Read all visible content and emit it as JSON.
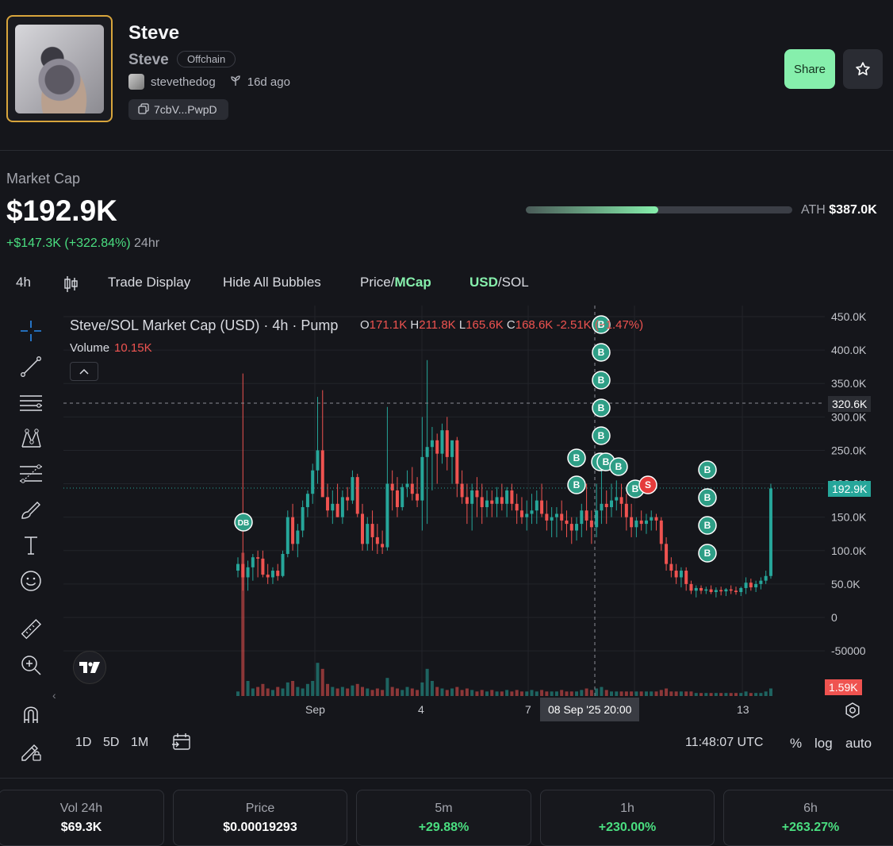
{
  "token": {
    "name": "Steve",
    "symbol": "Steve",
    "status_badge": "Offchain",
    "creator": "stevethedog",
    "age": "16d ago",
    "address": "7cbV...PwpD"
  },
  "actions": {
    "share_label": "Share",
    "favorite_icon": "star-icon"
  },
  "market_cap": {
    "label": "Market Cap",
    "value": "$192.9K",
    "change_abs": "+$147.3K",
    "change_pct": "(+322.84%)",
    "period": "24hr",
    "ath_label": "ATH",
    "ath_value": "$387.0K",
    "ath_progress": 0.498
  },
  "toolbar": {
    "interval": "4h",
    "candles_icon": "candlestick-icon",
    "trade_display": "Trade Display",
    "hide_bubbles": "Hide All Bubbles",
    "price_label": "Price",
    "mcap_label": "MCap",
    "usd_label": "USD",
    "sol_label": "SOL",
    "slash": "/"
  },
  "tools": [
    "crosshair-icon",
    "trendline-icon",
    "horizontal-lines-icon",
    "pattern-icon",
    "fib-icon",
    "brush-icon",
    "text-icon",
    "emoji-icon",
    "ruler-icon",
    "zoom-in-icon",
    "magnet-icon",
    "lock-drawing-icon"
  ],
  "chart_legend": {
    "title": "Steve/SOL Market Cap (USD) · 4h · Pump",
    "o_label": "O",
    "o": "171.1K",
    "h_label": "H",
    "h": "211.8K",
    "l_label": "L",
    "l": "165.6K",
    "c_label": "C",
    "c": "168.6K",
    "chg": "-2.51K",
    "chg_pct": "(−1.47%)",
    "volume_label": "Volume",
    "volume_value": "10.15K"
  },
  "y_axis_labels": [
    "450.0K",
    "400.0K",
    "350.0K",
    "300.0K",
    "250.0K",
    "200.0K",
    "150.0K",
    "100.0K",
    "50.0K",
    "0",
    "-50000"
  ],
  "price_tags": {
    "crosshair": "320.6K",
    "last": "192.9K",
    "volume": "1.59K"
  },
  "x_axis_labels": [
    "Sep",
    "4",
    "7",
    "13"
  ],
  "crosshair_time": "08 Sep '25   20:00",
  "bubbles": {
    "buy": "B",
    "sell": "S",
    "dev_buy": "DB"
  },
  "chart_data": {
    "type": "candlestick",
    "y_range": [
      -100000,
      460000
    ],
    "candles": [
      [
        70,
        90,
        60,
        80
      ],
      [
        80,
        365,
        40,
        60
      ],
      [
        60,
        85,
        40,
        75
      ],
      [
        75,
        95,
        55,
        90
      ],
      [
        90,
        100,
        60,
        88
      ],
      [
        88,
        100,
        60,
        64
      ],
      [
        64,
        80,
        50,
        60
      ],
      [
        60,
        75,
        50,
        70
      ],
      [
        70,
        80,
        55,
        62
      ],
      [
        62,
        100,
        60,
        95
      ],
      [
        95,
        160,
        90,
        150
      ],
      [
        150,
        170,
        100,
        110
      ],
      [
        110,
        140,
        90,
        130
      ],
      [
        130,
        175,
        120,
        165
      ],
      [
        165,
        190,
        150,
        185
      ],
      [
        185,
        230,
        170,
        220
      ],
      [
        220,
        330,
        200,
        250
      ],
      [
        250,
        340,
        190,
        180
      ],
      [
        180,
        200,
        150,
        160
      ],
      [
        160,
        190,
        140,
        170
      ],
      [
        170,
        200,
        150,
        150
      ],
      [
        150,
        190,
        140,
        180
      ],
      [
        180,
        195,
        160,
        175
      ],
      [
        175,
        220,
        170,
        210
      ],
      [
        210,
        215,
        150,
        155
      ],
      [
        155,
        170,
        100,
        110
      ],
      [
        110,
        150,
        100,
        140
      ],
      [
        140,
        160,
        100,
        120
      ],
      [
        120,
        140,
        95,
        110
      ],
      [
        110,
        130,
        95,
        105
      ],
      [
        105,
        315,
        100,
        200
      ],
      [
        200,
        220,
        160,
        190
      ],
      [
        190,
        210,
        150,
        165
      ],
      [
        165,
        200,
        160,
        195
      ],
      [
        195,
        220,
        180,
        200
      ],
      [
        200,
        225,
        175,
        185
      ],
      [
        185,
        210,
        165,
        175
      ],
      [
        175,
        300,
        130,
        240
      ],
      [
        240,
        385,
        140,
        255
      ],
      [
        255,
        285,
        190,
        265
      ],
      [
        265,
        275,
        200,
        245
      ],
      [
        245,
        290,
        230,
        280
      ],
      [
        280,
        300,
        220,
        240
      ],
      [
        240,
        250,
        200,
        265
      ],
      [
        265,
        270,
        180,
        200
      ],
      [
        200,
        220,
        170,
        180
      ],
      [
        180,
        200,
        140,
        170
      ],
      [
        170,
        200,
        130,
        190
      ],
      [
        190,
        210,
        150,
        180
      ],
      [
        180,
        200,
        140,
        165
      ],
      [
        165,
        190,
        150,
        175
      ],
      [
        175,
        190,
        150,
        170
      ],
      [
        170,
        195,
        150,
        180
      ],
      [
        180,
        200,
        160,
        170
      ],
      [
        170,
        195,
        150,
        190
      ],
      [
        190,
        200,
        160,
        170
      ],
      [
        170,
        185,
        140,
        160
      ],
      [
        160,
        180,
        140,
        150
      ],
      [
        150,
        175,
        130,
        155
      ],
      [
        155,
        185,
        140,
        160
      ],
      [
        160,
        190,
        140,
        175
      ],
      [
        175,
        200,
        150,
        155
      ],
      [
        155,
        175,
        130,
        145
      ],
      [
        145,
        165,
        120,
        150
      ],
      [
        150,
        165,
        120,
        155
      ],
      [
        155,
        175,
        130,
        145
      ],
      [
        145,
        160,
        120,
        140
      ],
      [
        140,
        150,
        110,
        130
      ],
      [
        130,
        150,
        115,
        140
      ],
      [
        140,
        170,
        120,
        160
      ],
      [
        160,
        200,
        130,
        145
      ],
      [
        145,
        160,
        110,
        135
      ],
      [
        135,
        200,
        120,
        160
      ],
      [
        160,
        220,
        140,
        170
      ],
      [
        170,
        190,
        140,
        165
      ],
      [
        165,
        200,
        150,
        175
      ],
      [
        175,
        205,
        160,
        180
      ],
      [
        180,
        200,
        150,
        170
      ],
      [
        170,
        185,
        130,
        150
      ],
      [
        150,
        170,
        120,
        135
      ],
      [
        135,
        150,
        120,
        145
      ],
      [
        145,
        160,
        130,
        140
      ],
      [
        140,
        155,
        125,
        145
      ],
      [
        145,
        160,
        130,
        150
      ],
      [
        150,
        155,
        130,
        145
      ],
      [
        145,
        150,
        100,
        110
      ],
      [
        110,
        120,
        70,
        80
      ],
      [
        80,
        90,
        60,
        70
      ],
      [
        70,
        80,
        50,
        60
      ],
      [
        60,
        75,
        45,
        70
      ],
      [
        70,
        75,
        40,
        50
      ],
      [
        50,
        55,
        35,
        40
      ],
      [
        40,
        48,
        30,
        44
      ],
      [
        44,
        48,
        35,
        40
      ],
      [
        40,
        46,
        35,
        42
      ],
      [
        42,
        48,
        35,
        38
      ],
      [
        38,
        45,
        30,
        41
      ],
      [
        41,
        46,
        33,
        39
      ],
      [
        39,
        44,
        32,
        42
      ],
      [
        42,
        48,
        35,
        40
      ],
      [
        40,
        46,
        34,
        38
      ],
      [
        38,
        46,
        32,
        44
      ],
      [
        44,
        60,
        35,
        52
      ],
      [
        52,
        58,
        40,
        45
      ],
      [
        45,
        55,
        38,
        50
      ],
      [
        50,
        60,
        42,
        55
      ],
      [
        55,
        70,
        50,
        62
      ],
      [
        62,
        200,
        58,
        193
      ]
    ],
    "volumes": [
      3,
      95,
      10,
      5,
      6,
      8,
      5,
      4,
      6,
      5,
      9,
      10,
      6,
      5,
      8,
      10,
      22,
      18,
      8,
      6,
      5,
      6,
      5,
      7,
      8,
      6,
      5,
      4,
      5,
      4,
      12,
      6,
      5,
      4,
      6,
      5,
      4,
      9,
      18,
      10,
      6,
      5,
      4,
      5,
      6,
      4,
      5,
      4,
      3,
      4,
      3,
      4,
      3,
      3,
      4,
      3,
      4,
      3,
      3,
      4,
      3,
      4,
      3,
      3,
      3,
      4,
      3,
      3,
      3,
      4,
      5,
      4,
      5,
      6,
      4,
      3,
      3,
      3,
      3,
      3,
      3,
      3,
      3,
      3,
      3,
      4,
      5,
      3,
      3,
      3,
      3,
      3,
      2,
      2,
      2,
      2,
      2,
      2,
      2,
      2,
      2,
      2,
      3,
      2,
      2,
      2,
      3,
      5
    ]
  },
  "range_buttons": [
    "1D",
    "5D",
    "1M"
  ],
  "calendar_icon": "calendar-range-icon",
  "clock": "11:48:07 UTC",
  "scale_options": [
    "%",
    "log",
    "auto"
  ],
  "stats": [
    {
      "label": "Vol 24h",
      "value": "$69.3K",
      "positive": false
    },
    {
      "label": "Price",
      "value": "$0.00019293",
      "positive": false
    },
    {
      "label": "5m",
      "value": "+29.88%",
      "positive": true
    },
    {
      "label": "1h",
      "value": "+230.00%",
      "positive": true
    },
    {
      "label": "6h",
      "value": "+263.27%",
      "positive": true
    }
  ]
}
